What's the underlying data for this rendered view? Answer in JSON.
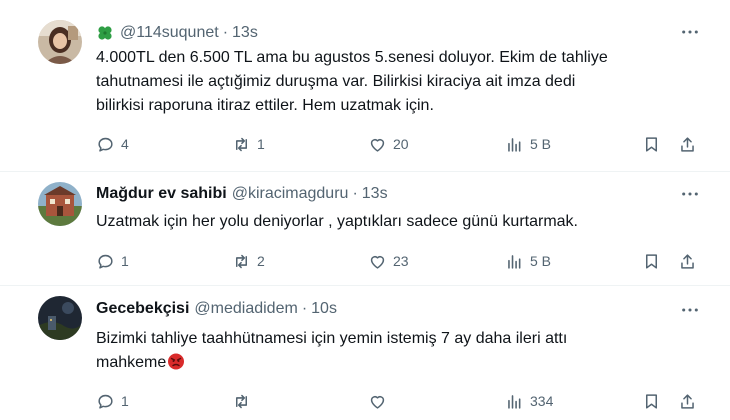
{
  "tweets": [
    {
      "display_name": "",
      "handle": "@114suqunet",
      "separator": "·",
      "time": "13s",
      "text_lines": [
        "4.000TL den 6.500 TL ama bu agustos 5.senesi doluyor. Ekim de tahliye",
        "tahutnamesi ile açtığimiz  duruşma var. Bilirkisi kiraciya ait imza dedi",
        "bilirkisi raporuna itiraz ettiler. Hem uzatmak için."
      ],
      "replies": "4",
      "retweets": "1",
      "likes": "20",
      "views": "5 B"
    },
    {
      "display_name": "Mağdur ev sahibi",
      "handle": "@kiracimagduru",
      "separator": "·",
      "time": "13s",
      "text_lines": [
        "Uzatmak için her yolu deniyorlar , yaptıkları sadece günü kurtarmak."
      ],
      "replies": "1",
      "retweets": "2",
      "likes": "23",
      "views": "5 B"
    },
    {
      "display_name": "Gecebekçisi",
      "handle": "@mediadidem",
      "separator": "·",
      "time": "10s",
      "text_lines": [
        "Bizimki tahliye taahhütnamesi için yemin istemiş 7 ay daha ileri attı",
        "mahkeme"
      ],
      "replies": "1",
      "retweets": "",
      "likes": "",
      "views": "334"
    }
  ],
  "icons": {
    "more": "more-dots-icon",
    "reply": "reply-icon",
    "retweet": "retweet-icon",
    "like": "heart-icon",
    "views": "views-bar-chart-icon",
    "bookmark": "bookmark-icon",
    "share": "share-icon",
    "clover": "four-leaf-clover-icon",
    "angry": "angry-face-emoji-icon"
  },
  "colors": {
    "text": "#0f1419",
    "secondary": "#536471",
    "border": "#eff3f4",
    "clover": "#2e9e44",
    "angry": "#d92b2b"
  }
}
